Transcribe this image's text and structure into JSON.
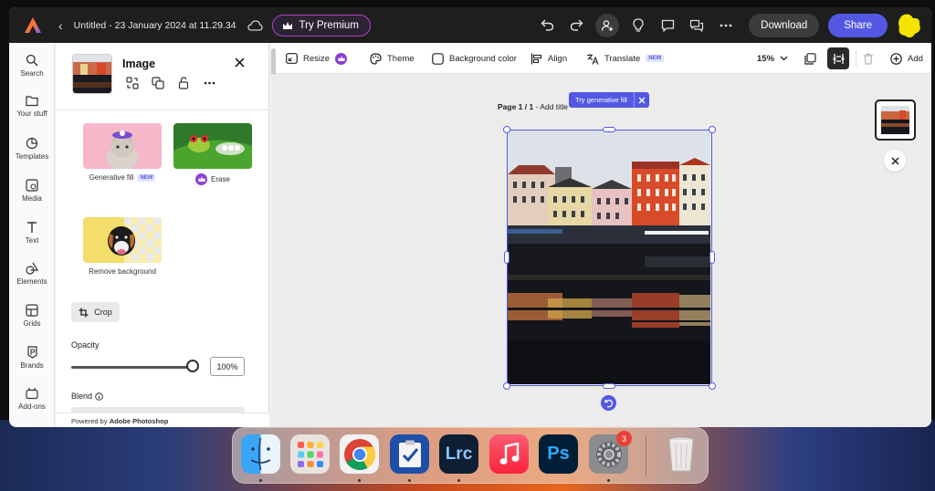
{
  "app": {
    "doc_title": "Untitled - 23 January 2024 at 11.29.34",
    "premium_label": "Try Premium",
    "download_label": "Download",
    "share_label": "Share"
  },
  "rail": {
    "items": [
      {
        "label": "Search",
        "icon": "search-icon"
      },
      {
        "label": "Your stuff",
        "icon": "folder-icon"
      },
      {
        "label": "Templates",
        "icon": "templates-icon"
      },
      {
        "label": "Media",
        "icon": "media-icon"
      },
      {
        "label": "Text",
        "icon": "text-icon"
      },
      {
        "label": "Elements",
        "icon": "elements-icon"
      },
      {
        "label": "Grids",
        "icon": "grids-icon"
      },
      {
        "label": "Brands",
        "icon": "brands-icon"
      },
      {
        "label": "Add-ons",
        "icon": "addons-icon"
      }
    ]
  },
  "panel": {
    "title": "Image",
    "effects": [
      {
        "label": "Generative fill",
        "badge": "NEW"
      },
      {
        "label": "Erase"
      },
      {
        "label": "Remove background"
      }
    ],
    "crop_label": "Crop",
    "opacity_label": "Opacity",
    "opacity_value": "100%",
    "opacity_fraction": 1.0,
    "blend_label": "Blend",
    "powered_prefix": "Powered by ",
    "powered_brand": "Adobe Photoshop"
  },
  "toolbar": {
    "resize": "Resize",
    "theme": "Theme",
    "background_color": "Background color",
    "align": "Align",
    "translate": "Translate",
    "translate_badge": "NEW",
    "zoom": "15%",
    "add": "Add"
  },
  "canvas": {
    "page_label_bold": "Page 1 / 1",
    "page_label_rest": " - Add title",
    "gen_fill_tip": "Try generative fill"
  },
  "dock": {
    "apps": [
      "Finder",
      "Launchpad",
      "Chrome",
      "Tasks",
      "Lightroom Classic",
      "Music",
      "Photoshop",
      "System Settings",
      "Trash"
    ],
    "lrc_text": "Lrc",
    "ps_text": "Ps",
    "settings_badge": "3"
  },
  "colors": {
    "accent": "#5258e4",
    "premium_border": "#b145c8",
    "topbar": "#1e1e1e"
  }
}
